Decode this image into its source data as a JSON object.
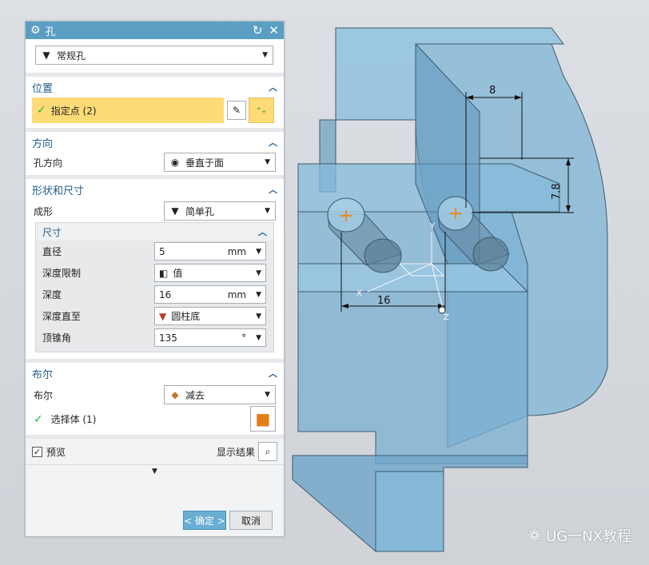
{
  "dialog": {
    "title": "孔",
    "type_value": "常规孔",
    "position": {
      "header": "位置",
      "specify_points": "指定点 (2)"
    },
    "direction": {
      "header": "方向",
      "label": "孔方向",
      "value": "垂直于面"
    },
    "shape": {
      "header": "形状和尺寸",
      "form_label": "成形",
      "form_value": "简单孔",
      "dimensions": {
        "header": "尺寸",
        "diameter_label": "直径",
        "diameter_value": "5",
        "diameter_unit": "mm",
        "depth_limit_label": "深度限制",
        "depth_limit_value": "值",
        "depth_label": "深度",
        "depth_value": "16",
        "depth_unit": "mm",
        "depth_to_label": "深度直至",
        "depth_to_value": "圆柱底",
        "tip_angle_label": "顶锥角",
        "tip_angle_value": "135",
        "tip_angle_unit": "°"
      }
    },
    "boolean": {
      "header": "布尔",
      "label": "布尔",
      "value": "减去",
      "select_body": "选择体 (1)"
    },
    "preview_label": "预览",
    "show_result_label": "显示结果",
    "ok_label": "< 确定 >",
    "cancel_label": "取消"
  },
  "viewport": {
    "dim_top": "8",
    "dim_right": "7.8",
    "dim_bottom": "16",
    "axis_x": "X",
    "axis_y": "Y",
    "axis_z": "Z"
  },
  "watermark": "UG一NX教程"
}
